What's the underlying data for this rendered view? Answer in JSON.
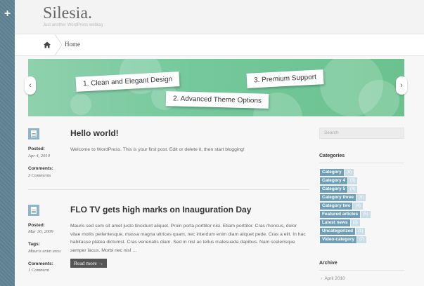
{
  "site": {
    "title": "Silesia.",
    "description": "Just another WordPress weblog"
  },
  "strip": {
    "toggle_glyph": "+"
  },
  "breadcrumb": {
    "home_icon": "home-icon",
    "current": "Home"
  },
  "slider": {
    "prev": "‹",
    "next": "›",
    "labels": [
      "1. Clean and Elegant Design",
      "2. Advanced Theme Options",
      "3. Premium Support"
    ]
  },
  "posts": [
    {
      "title": "Hello world!",
      "posted_label": "Posted:",
      "date": "Apr 4, 2010",
      "comments_label": "Comments:",
      "comments": "3 Comments",
      "excerpt": "Welcome to WordPress. This is your first post. Edit or delete it, then start blogging!"
    },
    {
      "title": "FLO TV gets high marks on Inauguration Day",
      "posted_label": "Posted:",
      "date": "Mar 30, 2009",
      "tags_label": "Tags:",
      "tags": "Mauris enim arcu",
      "comments_label": "Comments:",
      "comments": "1 Comment",
      "excerpt": "Mauris sed sem sit amet justo tincidunt aliquet. Proin porta porttitor nisi. Etiam porttitor. Cras rhoncus, dolor vitae mollis pellentesque, massa magna ultrices quam, nec interdum enim diam aliquet pede. Cras a elit. In hac habitasse platea dictumst. Cras venenatis diam. Sed in nisl ac tellus malesuada dapibus. Nam scelerisque semper lacus. Morbi nec nisl …",
      "read_more": "Read more →"
    }
  ],
  "sidebar": {
    "search_placeholder": "Search",
    "categories_title": "Categories",
    "categories": [
      {
        "name": "Category",
        "count": "(6)"
      },
      {
        "name": "Category 4",
        "count": "(5)"
      },
      {
        "name": "Category 5",
        "count": "(4)"
      },
      {
        "name": "Category three",
        "count": "(6)"
      },
      {
        "name": "Category two",
        "count": "(4)"
      },
      {
        "name": "Featured articles",
        "count": "(5)"
      },
      {
        "name": "Latest news",
        "count": "(3)"
      },
      {
        "name": "Uncategorized",
        "count": "(1)"
      },
      {
        "name": "Video-category",
        "count": "(7)"
      }
    ],
    "archive_title": "Archive",
    "archive_items": [
      "April 2010"
    ]
  },
  "colors": {
    "accent": "#6f9fb6",
    "strip": "#5b7f8f",
    "slider": "#74c89c"
  }
}
